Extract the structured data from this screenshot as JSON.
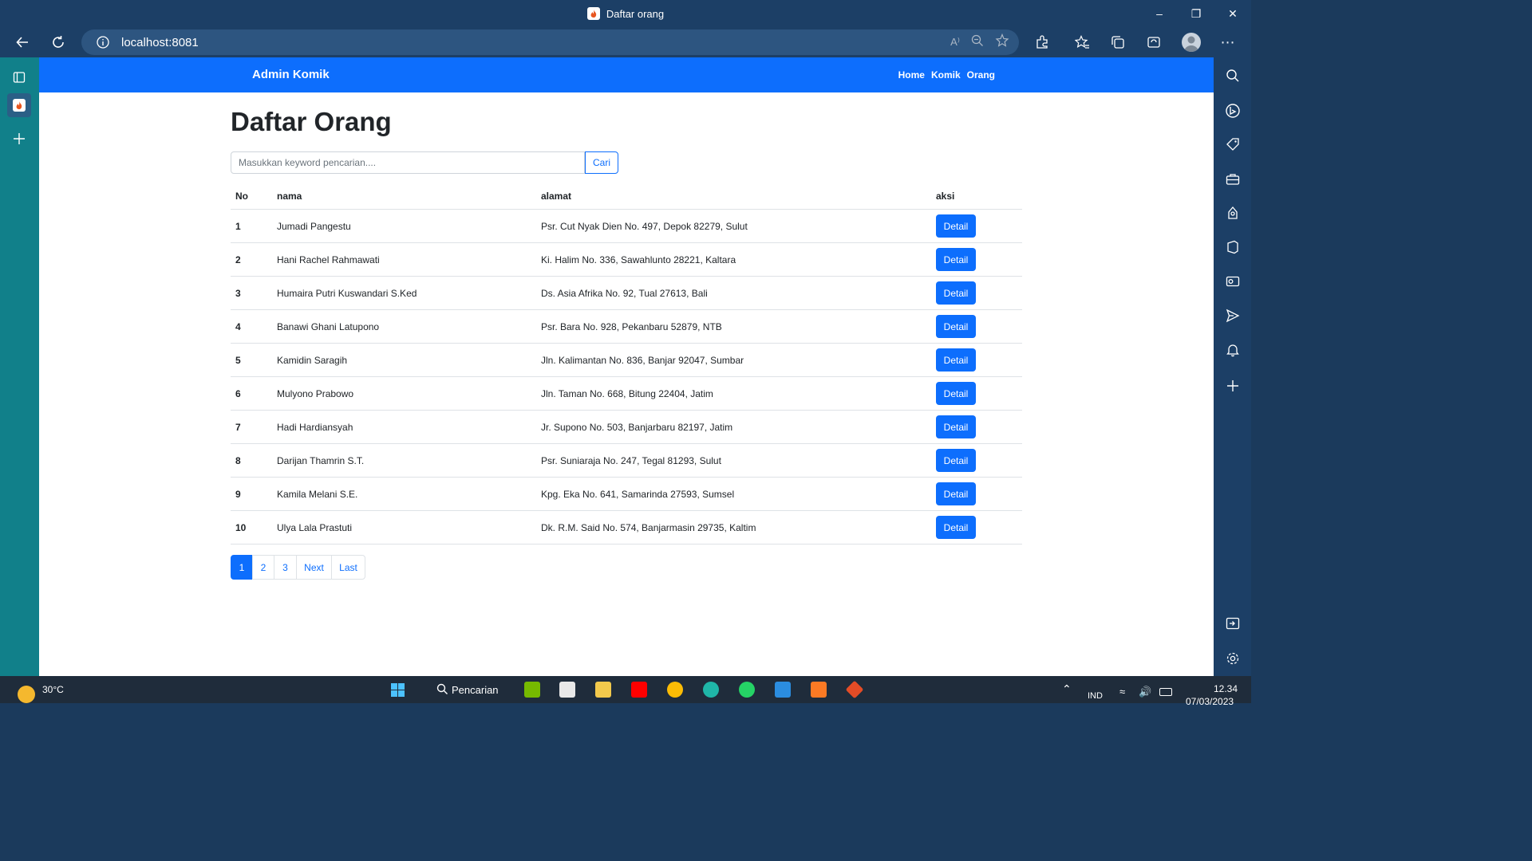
{
  "window": {
    "title": "Daftar orang"
  },
  "browser": {
    "url": "localhost:8081"
  },
  "navbar": {
    "brand": "Admin Komik",
    "links": [
      "Home",
      "Komik",
      "Orang"
    ]
  },
  "main": {
    "heading": "Daftar Orang",
    "search": {
      "placeholder": "Masukkan keyword pencarian....",
      "value": "",
      "button": "Cari"
    },
    "table": {
      "headers": [
        "No",
        "nama",
        "alamat",
        "aksi"
      ],
      "rows": [
        {
          "no": "1",
          "nama": "Jumadi Pangestu",
          "alamat": "Psr. Cut Nyak Dien No. 497, Depok 82279, Sulut",
          "aksi": "Detail"
        },
        {
          "no": "2",
          "nama": "Hani Rachel Rahmawati",
          "alamat": "Ki. Halim No. 336, Sawahlunto 28221, Kaltara",
          "aksi": "Detail"
        },
        {
          "no": "3",
          "nama": "Humaira Putri Kuswandari S.Ked",
          "alamat": "Ds. Asia Afrika No. 92, Tual 27613, Bali",
          "aksi": "Detail"
        },
        {
          "no": "4",
          "nama": "Banawi Ghani Latupono",
          "alamat": "Psr. Bara No. 928, Pekanbaru 52879, NTB",
          "aksi": "Detail"
        },
        {
          "no": "5",
          "nama": "Kamidin Saragih",
          "alamat": "Jln. Kalimantan No. 836, Banjar 92047, Sumbar",
          "aksi": "Detail"
        },
        {
          "no": "6",
          "nama": "Mulyono Prabowo",
          "alamat": "Jln. Taman No. 668, Bitung 22404, Jatim",
          "aksi": "Detail"
        },
        {
          "no": "7",
          "nama": "Hadi Hardiansyah",
          "alamat": "Jr. Supono No. 503, Banjarbaru 82197, Jatim",
          "aksi": "Detail"
        },
        {
          "no": "8",
          "nama": "Darijan Thamrin S.T.",
          "alamat": "Psr. Suniaraja No. 247, Tegal 81293, Sulut",
          "aksi": "Detail"
        },
        {
          "no": "9",
          "nama": "Kamila Melani S.E.",
          "alamat": "Kpg. Eka No. 641, Samarinda 27593, Sumsel",
          "aksi": "Detail"
        },
        {
          "no": "10",
          "nama": "Ulya Lala Prastuti",
          "alamat": "Dk. R.M. Said No. 574, Banjarmasin 29735, Kaltim",
          "aksi": "Detail"
        }
      ]
    },
    "pagination": [
      "1",
      "2",
      "3",
      "Next",
      "Last"
    ],
    "pagination_active": "1"
  },
  "taskbar": {
    "weather": "30°C",
    "search": "Pencarian",
    "lang": "IND",
    "time": "12.34",
    "date": "07/03/2023"
  },
  "colors": {
    "primary": "#0d6efd",
    "chrome": "#1c3f66",
    "sidebar": "#11808a"
  }
}
